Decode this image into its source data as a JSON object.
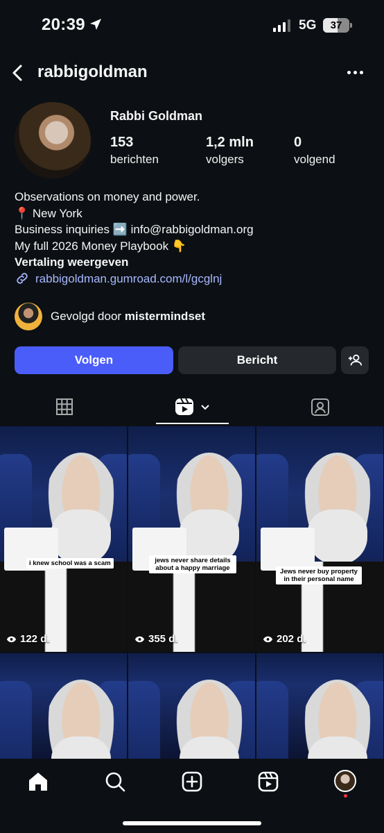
{
  "status": {
    "time": "20:39",
    "network": "5G",
    "battery": "37"
  },
  "header": {
    "username": "rabbigoldman"
  },
  "profile": {
    "full_name": "Rabbi Goldman",
    "stats": [
      {
        "value": "153",
        "label": "berichten"
      },
      {
        "value": "1,2 mln",
        "label": "volgers"
      },
      {
        "value": "0",
        "label": "volgend"
      }
    ]
  },
  "bio": {
    "line1": "Observations on money and power.",
    "line2": "📍 New York",
    "line3": "Business inquiries ➡️ info@rabbigoldman.org",
    "line4": "My full 2026 Money Playbook 👇",
    "translate": "Vertaling weergeven",
    "link": "rabbigoldman.gumroad.com/l/gcglnj"
  },
  "followed_by": {
    "prefix": "Gevolgd door",
    "name": "mistermindset"
  },
  "buttons": {
    "follow": "Volgen",
    "message": "Bericht"
  },
  "reels": [
    {
      "caption": "i knew school was a scam",
      "views": "122 d."
    },
    {
      "caption": "jews never share details about a happy marriage",
      "views": "355 d."
    },
    {
      "caption": "Jews never buy property in their personal name",
      "views": "202 d."
    }
  ],
  "colors": {
    "accent": "#4a5df9",
    "link": "#a7b8ff",
    "background": "#0c1014"
  }
}
